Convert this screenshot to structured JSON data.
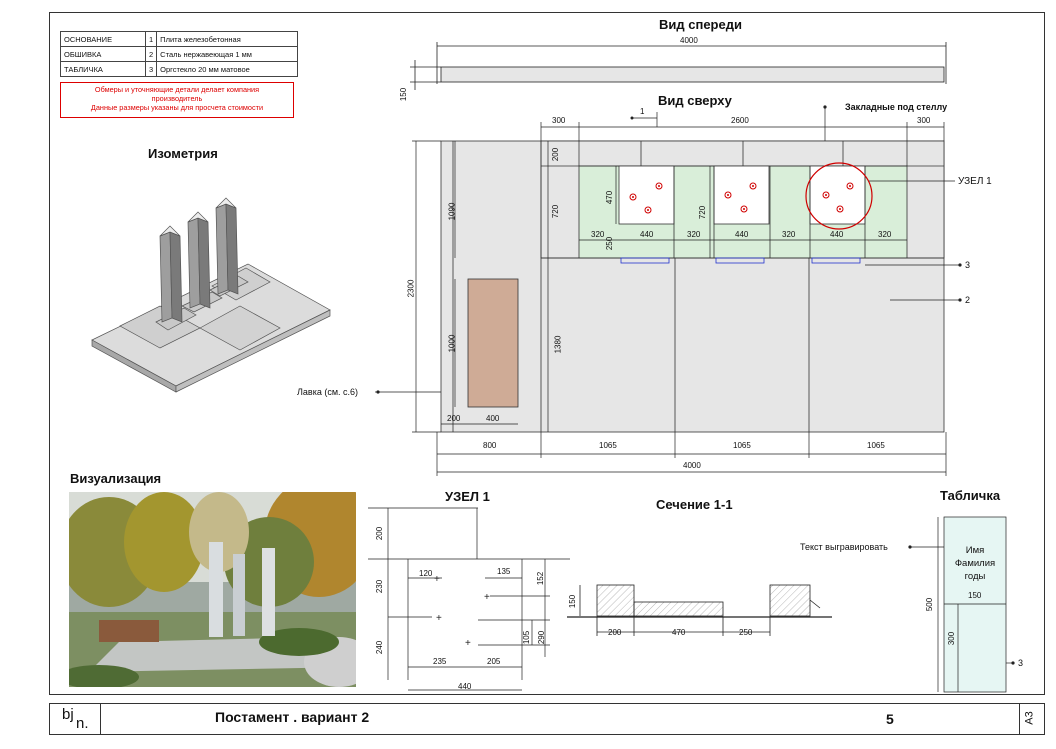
{
  "legend": [
    {
      "name": "ОСНОВАНИЕ",
      "num": "1",
      "material": "Плита железобетонная"
    },
    {
      "name": "ОБШИВКА",
      "num": "2",
      "material": "Сталь нержавеющая 1 мм"
    },
    {
      "name": "ТАБЛИЧКА",
      "num": "3",
      "material": "Оргстекло 20 мм матовое"
    }
  ],
  "note": {
    "line1": "Обмеры и уточняющие детали делает компания",
    "line2": "производитель",
    "line3": "Данные размеры указаны для просчета стоимости"
  },
  "titles": {
    "front": "Вид спереди",
    "top": "Вид сверху",
    "iso": "Изометрия",
    "viz": "Визуализация",
    "node": "УЗЕЛ 1",
    "section": "Сечение 1-1",
    "plaque": "Табличка"
  },
  "front": {
    "w": "4000",
    "h": "150"
  },
  "top": {
    "d300a": "300",
    "d2600": "2600",
    "d300b": "300",
    "cut": "1",
    "embed": "Закладные под стеллу",
    "node": "УЗЕЛ 1",
    "d200": "200",
    "d720a": "720",
    "d720b": "720",
    "d470": "470",
    "d250": "250",
    "d1090": "1090",
    "d2300": "2300",
    "d1000": "1000",
    "d1380": "1380",
    "row": [
      "320",
      "440",
      "320",
      "440",
      "320",
      "440",
      "320"
    ],
    "bench": "Лавка (см. с.6)",
    "b200": "200",
    "b400": "400",
    "bot800": "800",
    "bot1065a": "1065",
    "bot1065b": "1065",
    "bot1065c": "1065",
    "total": "4000",
    "lbl3": "3",
    "lbl2": "2"
  },
  "node": {
    "d200": "200",
    "d230": "230",
    "d240": "240",
    "d120": "120",
    "d135": "135",
    "d152": "152",
    "d105": "105",
    "d290": "290",
    "d235": "235",
    "d205": "205",
    "d440": "440"
  },
  "section": {
    "d150": "150",
    "d200": "200",
    "d470": "470",
    "d250": "250"
  },
  "plaque": {
    "engrave": "Текст выгравировать",
    "name": "Имя",
    "surname": "Фамилия",
    "years": "годы",
    "d150": "150",
    "d500": "500",
    "d300": "300",
    "lbl3": "3"
  },
  "footer": {
    "logo": "bj",
    "logo2": "n.",
    "title": "Постамент . вариант 2",
    "page": "5",
    "format": "А3"
  },
  "colors": {
    "slab": "#e6e6e6",
    "green": "#d9eed9",
    "bench": "#cfab96",
    "red": "#d00000",
    "plaque": "#e6f6f3",
    "blue": "#2233cc"
  }
}
